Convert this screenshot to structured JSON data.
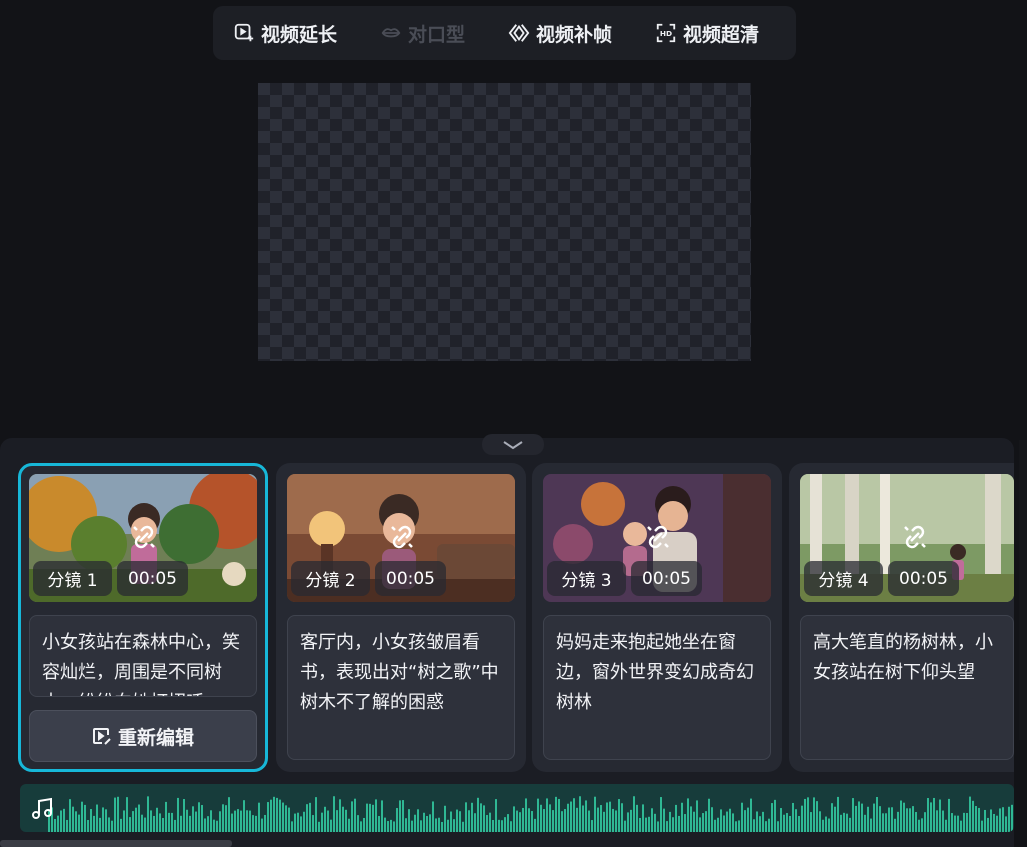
{
  "toolbar": {
    "items": [
      {
        "label": "视频延长",
        "icon": "video-extend-icon",
        "enabled": true
      },
      {
        "label": "对口型",
        "icon": "lip-sync-icon",
        "enabled": false
      },
      {
        "label": "视频补帧",
        "icon": "frame-interpolation-icon",
        "enabled": true
      },
      {
        "label": "视频超清",
        "icon": "hd-icon",
        "enabled": true
      }
    ]
  },
  "shots": [
    {
      "label": "分镜 1",
      "time": "00:05",
      "description": "小女孩站在森林中心，笑容灿烂，周围是不同树木，纷纷向她打招呼",
      "selected": true,
      "action": "重新编辑"
    },
    {
      "label": "分镜 2",
      "time": "00:05",
      "description": "客厅内，小女孩皱眉看书，表现出对“树之歌”中树木不了解的困惑",
      "selected": false
    },
    {
      "label": "分镜 3",
      "time": "00:05",
      "description": "妈妈走来抱起她坐在窗边，窗外世界变幻成奇幻树林",
      "selected": false
    },
    {
      "label": "分镜 4",
      "time": "00:05",
      "description": "高大笔直的杨树林，小女孩站在树下仰头望",
      "selected": false
    }
  ],
  "colors": {
    "accent": "#17b7d8",
    "waveform": "#2fb894",
    "background": "#121317"
  },
  "audio_track": {
    "icon": "music-note-icon"
  }
}
